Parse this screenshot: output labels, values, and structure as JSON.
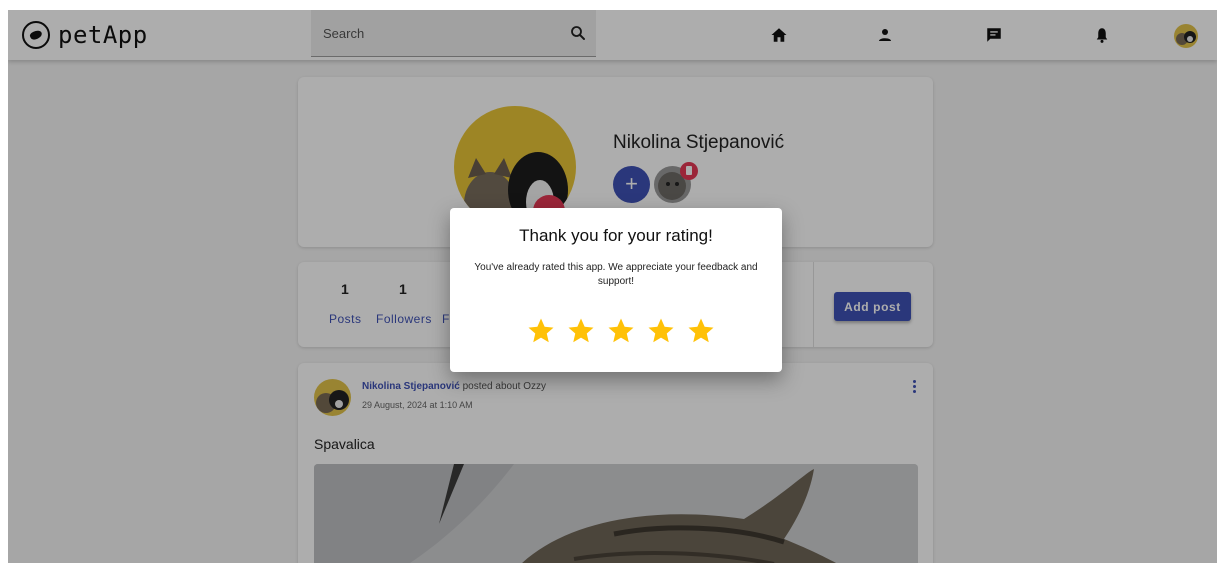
{
  "header": {
    "brand": "petApp",
    "search_placeholder": "Search",
    "icons": [
      "pet-logo-icon",
      "search-icon",
      "home-icon",
      "person-icon",
      "chat-icon",
      "bell-icon",
      "avatar"
    ]
  },
  "profile": {
    "name": "Nikolina Stjepanović",
    "add_pet_label": "+"
  },
  "stats": {
    "posts_count": "1",
    "followers_count": "1",
    "posts_label": "Posts",
    "followers_label": "Followers",
    "following_label": "F",
    "add_post_label": "Add post"
  },
  "post": {
    "author": "Nikolina Stjepanović",
    "action": " posted about Ozzy",
    "date": "29 August, 2024 at 1:10 AM",
    "title": "Spavalica"
  },
  "dialog": {
    "title": "Thank you for your rating!",
    "message": "You've already rated this app. We appreciate your feedback and support!",
    "rating": 5,
    "max_rating": 5
  },
  "colors": {
    "primary": "#3f51b5",
    "accent": "#e53955",
    "star": "#ffc107",
    "overlay": "rgba(0,0,0,0.32)"
  }
}
